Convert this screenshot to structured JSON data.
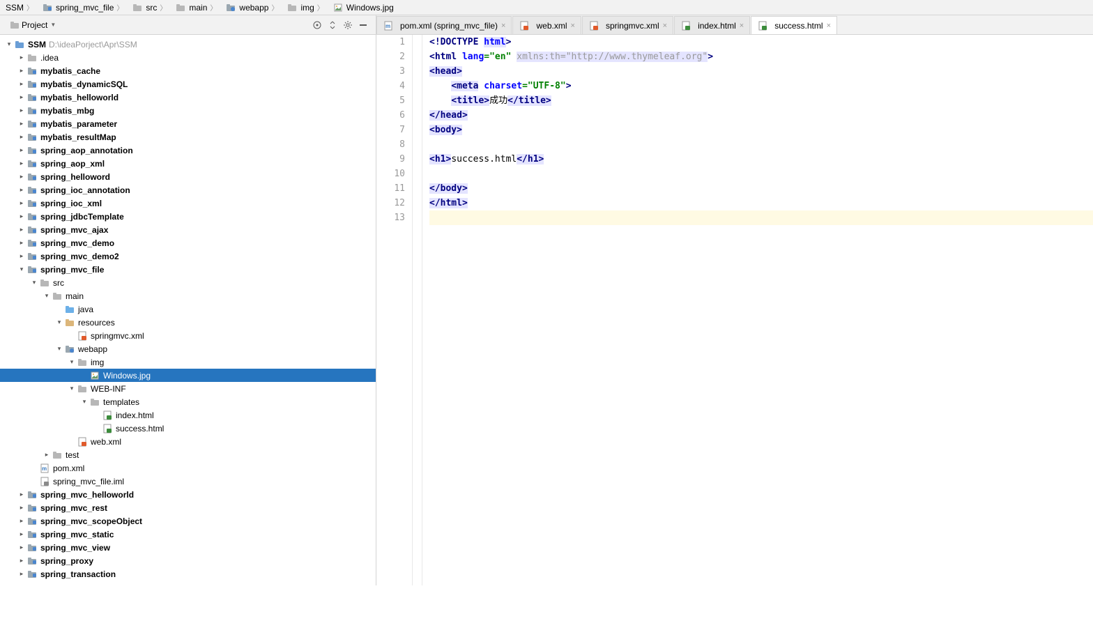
{
  "breadcrumbs": [
    {
      "label": "SSM",
      "icon": "folder",
      "hasIcon": false
    },
    {
      "label": "spring_mvc_file",
      "icon": "module"
    },
    {
      "label": "src",
      "icon": "folder"
    },
    {
      "label": "main",
      "icon": "folder"
    },
    {
      "label": "webapp",
      "icon": "webfolder"
    },
    {
      "label": "img",
      "icon": "folder"
    },
    {
      "label": "Windows.jpg",
      "icon": "image"
    }
  ],
  "project_button": "Project",
  "root_path": "D:\\ideaPorject\\Apr\\SSM",
  "tree": [
    {
      "depth": 0,
      "exp": "down",
      "icon": "project",
      "label": "SSM",
      "bold": true,
      "path": "D:\\ideaPorject\\Apr\\SSM"
    },
    {
      "depth": 1,
      "exp": "right",
      "icon": "folder",
      "label": ".idea",
      "bold": false
    },
    {
      "depth": 1,
      "exp": "right",
      "icon": "module",
      "label": "mybatis_cache",
      "bold": true
    },
    {
      "depth": 1,
      "exp": "right",
      "icon": "module",
      "label": "mybatis_dynamicSQL",
      "bold": true
    },
    {
      "depth": 1,
      "exp": "right",
      "icon": "module",
      "label": "mybatis_helloworld",
      "bold": true
    },
    {
      "depth": 1,
      "exp": "right",
      "icon": "module",
      "label": "mybatis_mbg",
      "bold": true
    },
    {
      "depth": 1,
      "exp": "right",
      "icon": "module",
      "label": "mybatis_parameter",
      "bold": true
    },
    {
      "depth": 1,
      "exp": "right",
      "icon": "module",
      "label": "mybatis_resultMap",
      "bold": true
    },
    {
      "depth": 1,
      "exp": "right",
      "icon": "module",
      "label": "spring_aop_annotation",
      "bold": true
    },
    {
      "depth": 1,
      "exp": "right",
      "icon": "module",
      "label": "spring_aop_xml",
      "bold": true
    },
    {
      "depth": 1,
      "exp": "right",
      "icon": "module",
      "label": "spring_helloword",
      "bold": true
    },
    {
      "depth": 1,
      "exp": "right",
      "icon": "module",
      "label": "spring_ioc_annotation",
      "bold": true
    },
    {
      "depth": 1,
      "exp": "right",
      "icon": "module",
      "label": "spring_ioc_xml",
      "bold": true
    },
    {
      "depth": 1,
      "exp": "right",
      "icon": "module",
      "label": "spring_jdbcTemplate",
      "bold": true
    },
    {
      "depth": 1,
      "exp": "right",
      "icon": "module",
      "label": "spring_mvc_ajax",
      "bold": true
    },
    {
      "depth": 1,
      "exp": "right",
      "icon": "module",
      "label": "spring_mvc_demo",
      "bold": true
    },
    {
      "depth": 1,
      "exp": "right",
      "icon": "module",
      "label": "spring_mvc_demo2",
      "bold": true
    },
    {
      "depth": 1,
      "exp": "down",
      "icon": "module",
      "label": "spring_mvc_file",
      "bold": true
    },
    {
      "depth": 2,
      "exp": "down",
      "icon": "folder",
      "label": "src",
      "bold": false
    },
    {
      "depth": 3,
      "exp": "down",
      "icon": "folder",
      "label": "main",
      "bold": false
    },
    {
      "depth": 4,
      "exp": "none",
      "icon": "srcfolder",
      "label": "java",
      "bold": false
    },
    {
      "depth": 4,
      "exp": "down",
      "icon": "resfolder",
      "label": "resources",
      "bold": false
    },
    {
      "depth": 5,
      "exp": "none",
      "icon": "xml",
      "label": "springmvc.xml",
      "bold": false
    },
    {
      "depth": 4,
      "exp": "down",
      "icon": "webfolder",
      "label": "webapp",
      "bold": false
    },
    {
      "depth": 5,
      "exp": "down",
      "icon": "folder",
      "label": "img",
      "bold": false
    },
    {
      "depth": 6,
      "exp": "none",
      "icon": "image",
      "label": "Windows.jpg",
      "bold": false,
      "selected": true
    },
    {
      "depth": 5,
      "exp": "down",
      "icon": "folder",
      "label": "WEB-INF",
      "bold": false
    },
    {
      "depth": 6,
      "exp": "down",
      "icon": "folder",
      "label": "templates",
      "bold": false
    },
    {
      "depth": 7,
      "exp": "none",
      "icon": "html",
      "label": "index.html",
      "bold": false
    },
    {
      "depth": 7,
      "exp": "none",
      "icon": "html",
      "label": "success.html",
      "bold": false
    },
    {
      "depth": 5,
      "exp": "none",
      "icon": "xml",
      "label": "web.xml",
      "bold": false
    },
    {
      "depth": 3,
      "exp": "right",
      "icon": "folder",
      "label": "test",
      "bold": false
    },
    {
      "depth": 2,
      "exp": "none",
      "icon": "pom",
      "label": "pom.xml",
      "bold": false
    },
    {
      "depth": 2,
      "exp": "none",
      "icon": "iml",
      "label": "spring_mvc_file.iml",
      "bold": false
    },
    {
      "depth": 1,
      "exp": "right",
      "icon": "module",
      "label": "spring_mvc_helloworld",
      "bold": true
    },
    {
      "depth": 1,
      "exp": "right",
      "icon": "module",
      "label": "spring_mvc_rest",
      "bold": true
    },
    {
      "depth": 1,
      "exp": "right",
      "icon": "module",
      "label": "spring_mvc_scopeObject",
      "bold": true
    },
    {
      "depth": 1,
      "exp": "right",
      "icon": "module",
      "label": "spring_mvc_static",
      "bold": true
    },
    {
      "depth": 1,
      "exp": "right",
      "icon": "module",
      "label": "spring_mvc_view",
      "bold": true
    },
    {
      "depth": 1,
      "exp": "right",
      "icon": "module",
      "label": "spring_proxy",
      "bold": true
    },
    {
      "depth": 1,
      "exp": "right",
      "icon": "module",
      "label": "spring_transaction",
      "bold": true
    }
  ],
  "tabs": [
    {
      "icon": "pom",
      "label": "pom.xml (spring_mvc_file)",
      "active": false
    },
    {
      "icon": "xml",
      "label": "web.xml",
      "active": false
    },
    {
      "icon": "xml",
      "label": "springmvc.xml",
      "active": false
    },
    {
      "icon": "html",
      "label": "index.html",
      "active": false
    },
    {
      "icon": "html",
      "label": "success.html",
      "active": true
    }
  ],
  "lines": [
    {
      "n": 1,
      "html": "<span class='t-tag'>&lt;!DOCTYPE</span> <span class='t-attr hl'>html</span><span class='t-tag'>&gt;</span>"
    },
    {
      "n": 2,
      "html": "<span class='t-tag'>&lt;html</span> <span class='t-attr'>lang</span><span class='t-val'>=\"en\"</span> <span class='t-comment hl'>xmlns:th=\"http://www.thymeleaf.org\"</span><span class='t-tag'>&gt;</span>"
    },
    {
      "n": 3,
      "html": "<span class='t-tag hl'>&lt;head&gt;</span>"
    },
    {
      "n": 4,
      "html": "&nbsp;&nbsp;&nbsp;&nbsp;<span class='t-tag hl'>&lt;meta</span> <span class='t-attr'>charset</span><span class='t-val'>=\"UTF-8\"</span><span class='t-tag'>&gt;</span>"
    },
    {
      "n": 5,
      "html": "&nbsp;&nbsp;&nbsp;&nbsp;<span class='t-tag hl'>&lt;title&gt;</span><span class='t-text'>成功</span><span class='t-tag hl'>&lt;/title&gt;</span>"
    },
    {
      "n": 6,
      "html": "<span class='t-tag hl'>&lt;/head&gt;</span>"
    },
    {
      "n": 7,
      "html": "<span class='t-tag hl'>&lt;body&gt;</span>"
    },
    {
      "n": 8,
      "html": ""
    },
    {
      "n": 9,
      "html": "<span class='t-tag hl'>&lt;h1&gt;</span><span class='t-text'>success.html</span><span class='t-tag hl'>&lt;/h1&gt;</span>"
    },
    {
      "n": 10,
      "html": ""
    },
    {
      "n": 11,
      "html": "<span class='t-tag hl'>&lt;/body&gt;</span>"
    },
    {
      "n": 12,
      "html": "<span class='t-tag hl'>&lt;/html&gt;</span>"
    },
    {
      "n": 13,
      "html": "",
      "current": true
    }
  ]
}
